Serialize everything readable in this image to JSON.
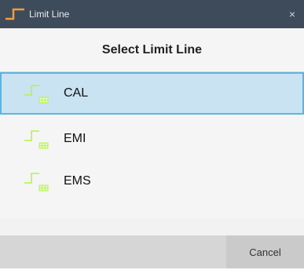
{
  "window": {
    "title": "Limit Line",
    "title_icon": "limit-line-step-icon",
    "close_glyph": "×",
    "close_icon": "close-icon",
    "accent_color": "#f39c3c"
  },
  "dialog": {
    "heading": "Select Limit Line"
  },
  "limit_lines": [
    {
      "label": "CAL",
      "icon": "limit-line-icon",
      "selected": true
    },
    {
      "label": "EMI",
      "icon": "limit-line-icon",
      "selected": false
    },
    {
      "label": "EMS",
      "icon": "limit-line-icon",
      "selected": false
    }
  ],
  "colors": {
    "titlebar": "#3e4b5a",
    "selection_fill": "#c9e3f3",
    "selection_border": "#5eb4de",
    "icon_green": "#b6f24a"
  },
  "footer": {
    "cancel_label": "Cancel"
  }
}
